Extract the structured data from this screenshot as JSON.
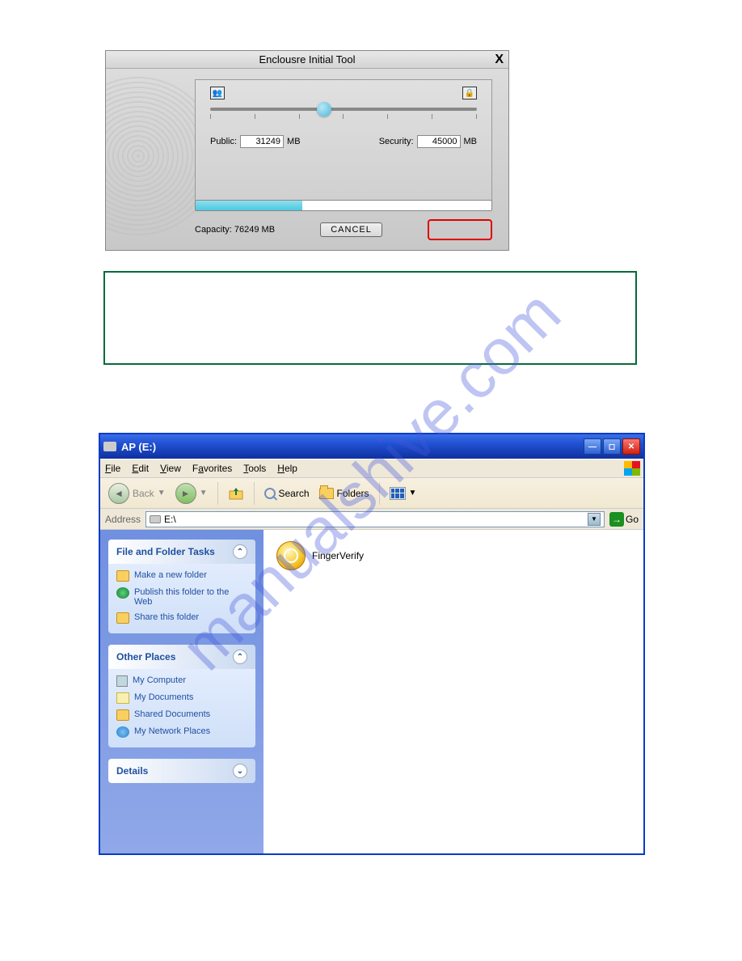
{
  "watermark": "manualshive.com",
  "tool": {
    "title": "Enclousre Initial Tool",
    "public_label": "Public:",
    "public_value": "31249",
    "public_unit": "MB",
    "security_label": "Security:",
    "security_value": "45000",
    "security_unit": "MB",
    "capacity_label": "Capacity: 76249 MB",
    "cancel": "CANCEL"
  },
  "explorer": {
    "title": "AP (E:)",
    "menu": {
      "file": "File",
      "edit": "Edit",
      "view": "View",
      "favorites": "Favorites",
      "tools": "Tools",
      "help": "Help"
    },
    "toolbar": {
      "back": "Back",
      "search": "Search",
      "folders": "Folders"
    },
    "address_label": "Address",
    "address_value": "E:\\",
    "go": "Go",
    "sidebar": {
      "tasks_header": "File and Folder Tasks",
      "tasks": {
        "new_folder": "Make a new folder",
        "publish": "Publish this folder to the Web",
        "share": "Share this folder"
      },
      "places_header": "Other Places",
      "places": {
        "my_computer": "My Computer",
        "my_documents": "My Documents",
        "shared_documents": "Shared Documents",
        "network_places": "My Network Places"
      },
      "details_header": "Details"
    },
    "file": "FingerVerify"
  }
}
